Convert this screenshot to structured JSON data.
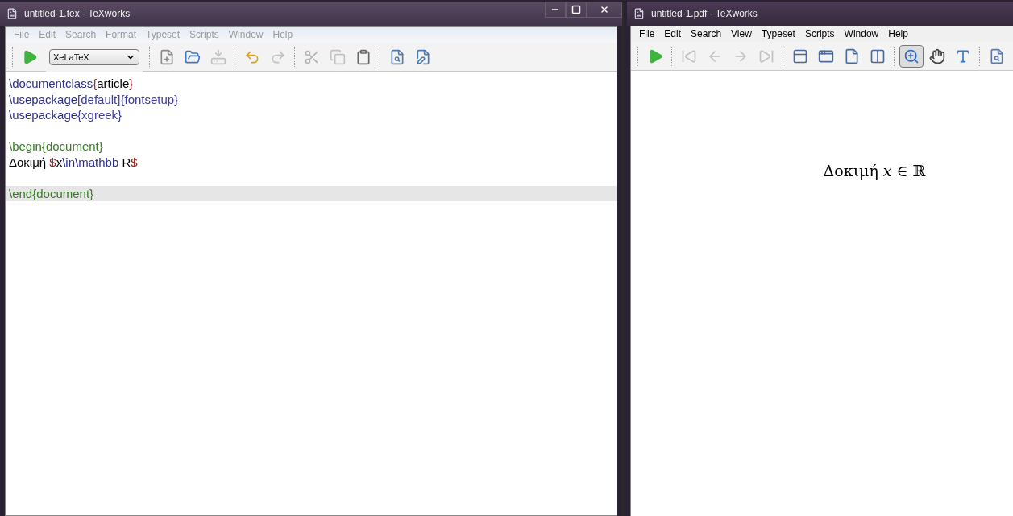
{
  "editor_window": {
    "title": "untitled-1.tex - TeXworks",
    "active": false,
    "controls": [
      {
        "kind": "minimize"
      },
      {
        "kind": "maximize"
      },
      {
        "kind": "close"
      }
    ],
    "menu": [
      "File",
      "Edit",
      "Search",
      "Format",
      "Typeset",
      "Scripts",
      "Window",
      "Help"
    ],
    "engine": {
      "value": "XeLaTeX"
    },
    "toolbar": [
      {
        "tools": [
          {
            "kind": "typeset",
            "disabled": false
          }
        ]
      },
      {
        "tools": [
          {
            "kind": "new",
            "disabled": false
          },
          {
            "kind": "open",
            "disabled": false
          },
          {
            "kind": "save",
            "disabled": true
          }
        ]
      },
      {
        "tools": [
          {
            "kind": "undo",
            "disabled": false
          },
          {
            "kind": "redo",
            "disabled": true
          }
        ]
      },
      {
        "tools": [
          {
            "kind": "cut",
            "disabled": true
          },
          {
            "kind": "copy",
            "disabled": true
          },
          {
            "kind": "paste",
            "disabled": false
          }
        ]
      },
      {
        "tools": [
          {
            "kind": "preview",
            "disabled": false
          },
          {
            "kind": "find",
            "disabled": false
          }
        ]
      }
    ],
    "lines": [
      {
        "current": false,
        "segments": [
          {
            "text": "\\documentclass",
            "kind": "command"
          },
          {
            "text": "{",
            "kind": "brace"
          },
          {
            "text": "article",
            "kind": "plain"
          },
          {
            "text": "}",
            "kind": "brace"
          }
        ]
      },
      {
        "current": false,
        "segments": [
          {
            "text": "\\usepackage",
            "kind": "command"
          },
          {
            "text": "[default]{fontsetup}",
            "kind": "arg"
          }
        ]
      },
      {
        "current": false,
        "segments": [
          {
            "text": "\\usepackage",
            "kind": "command"
          },
          {
            "text": "{xgreek}",
            "kind": "arg"
          }
        ]
      },
      {
        "current": false
      },
      {
        "current": false,
        "segments": [
          {
            "text": "\\begin{document}",
            "kind": "env"
          }
        ]
      },
      {
        "current": false,
        "segments": [
          {
            "text": "Δοκιμή ",
            "kind": "plain"
          },
          {
            "text": "$",
            "kind": "math"
          },
          {
            "text": "x",
            "kind": "plain"
          },
          {
            "text": "\\in\\mathbb",
            "kind": "command"
          },
          {
            "text": " R",
            "kind": "plain"
          },
          {
            "text": "$",
            "kind": "math"
          }
        ]
      },
      {
        "current": false
      },
      {
        "current": true,
        "segments": [
          {
            "text": "\\end{document}",
            "kind": "env"
          }
        ]
      }
    ]
  },
  "pdf_window": {
    "title": "untitled-1.pdf - TeXworks",
    "active": true,
    "menu": [
      "File",
      "Edit",
      "Search",
      "View",
      "Typeset",
      "Scripts",
      "Window",
      "Help"
    ],
    "toolbar": [
      {
        "tools": [
          {
            "kind": "typeset",
            "disabled": false,
            "selected": false
          }
        ]
      },
      {
        "tools": [
          {
            "kind": "first",
            "disabled": true,
            "selected": false
          },
          {
            "kind": "prev",
            "disabled": true,
            "selected": false
          },
          {
            "kind": "next",
            "disabled": true,
            "selected": false
          },
          {
            "kind": "last",
            "disabled": true,
            "selected": false
          }
        ]
      },
      {
        "tools": [
          {
            "kind": "single",
            "disabled": false,
            "selected": false
          },
          {
            "kind": "facing",
            "disabled": false,
            "selected": false
          },
          {
            "kind": "fitpage",
            "disabled": false,
            "selected": false
          },
          {
            "kind": "fitwidth",
            "disabled": false,
            "selected": false
          }
        ]
      },
      {
        "tools": [
          {
            "kind": "zoom",
            "disabled": false,
            "selected": true
          },
          {
            "kind": "hand",
            "disabled": false,
            "selected": false
          },
          {
            "kind": "select",
            "disabled": false,
            "selected": false
          }
        ]
      },
      {
        "tools": [
          {
            "kind": "preview",
            "disabled": false,
            "selected": false
          }
        ]
      }
    ],
    "page_text": [
      {
        "text": "Δοκιμή",
        "kind": "text"
      },
      {
        "text": "x",
        "kind": "math-italic"
      },
      {
        "text": "∈",
        "kind": "math"
      },
      {
        "text": "ℝ",
        "kind": "math"
      }
    ]
  }
}
